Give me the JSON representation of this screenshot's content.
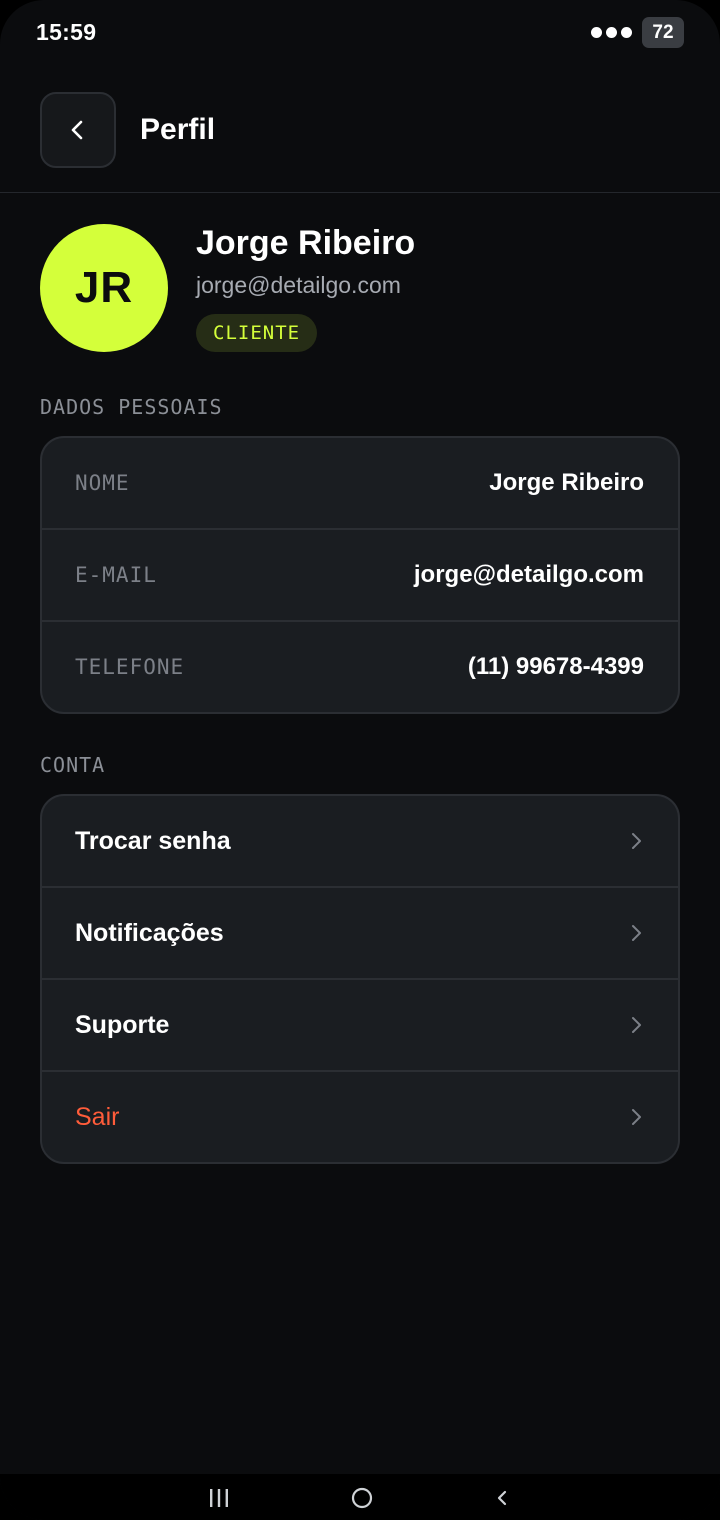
{
  "status_bar": {
    "time": "15:59",
    "battery": "72"
  },
  "header": {
    "title": "Perfil",
    "back_icon": "chevron-left-icon"
  },
  "profile": {
    "initials": "JR",
    "name": "Jorge Ribeiro",
    "email": "jorge@detailgo.com",
    "role": "CLIENTE"
  },
  "personal": {
    "section_label": "DADOS PESSOAIS",
    "fields": [
      {
        "label": "NOME",
        "value": "Jorge Ribeiro"
      },
      {
        "label": "E-MAIL",
        "value": "jorge@detailgo.com"
      },
      {
        "label": "TELEFONE",
        "value": "(11) 99678-4399"
      }
    ]
  },
  "account": {
    "section_label": "CONTA",
    "items": [
      {
        "label": "Trocar senha"
      },
      {
        "label": "Notificações"
      },
      {
        "label": "Suporte"
      },
      {
        "label": "Sair"
      }
    ]
  },
  "colors": {
    "background": "#0b0c0e",
    "card": "#1a1d21",
    "accent": "#d4ff3a",
    "danger": "#ff5c3a"
  },
  "nav_icons": [
    "recent-apps-icon",
    "home-icon",
    "back-icon"
  ]
}
